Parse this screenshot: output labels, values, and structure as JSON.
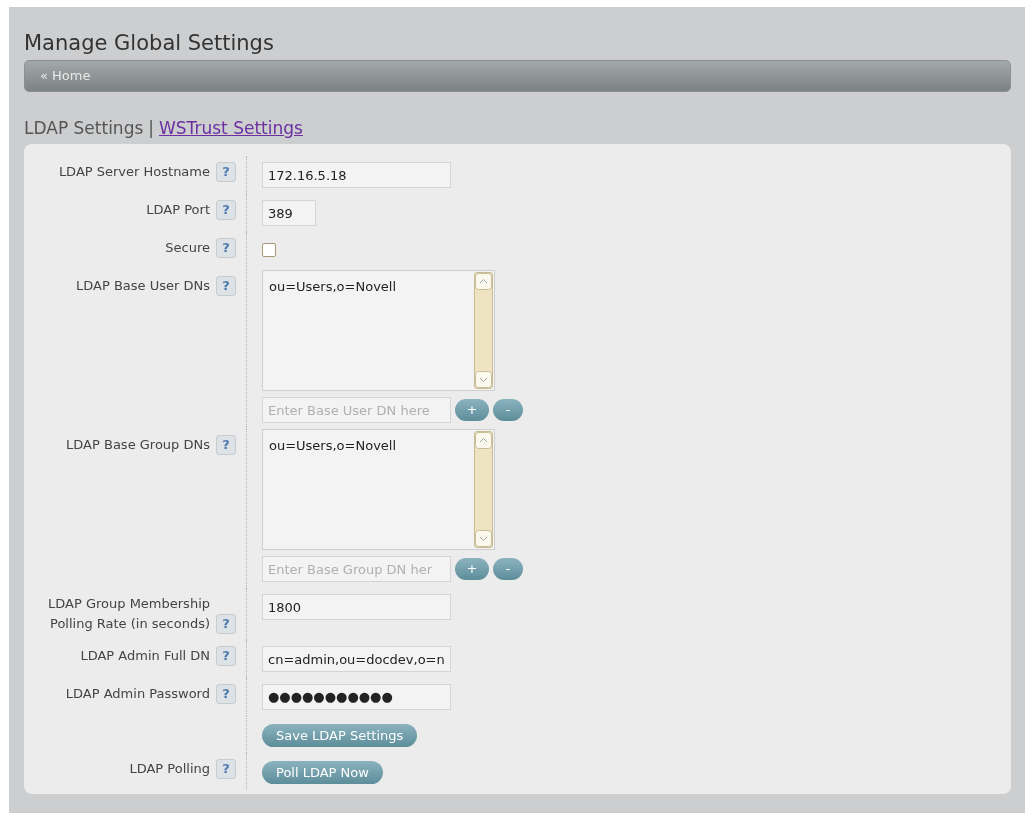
{
  "page": {
    "title": "Manage Global Settings"
  },
  "breadcrumb": {
    "label": "« Home"
  },
  "section_links": [
    {
      "label": "LDAP Settings",
      "kind": "current"
    },
    {
      "label": "WSTrust Settings",
      "kind": "link"
    }
  ],
  "section_separator": "|",
  "rows": [
    {
      "kind": "text",
      "label": "LDAP Server Hostname",
      "help": "?",
      "value": "172.16.5.18"
    },
    {
      "kind": "short_text",
      "label": "LDAP Port",
      "help": "?",
      "value": "389"
    },
    {
      "kind": "checkbox",
      "label": "Secure",
      "help": "?",
      "checked": false
    },
    {
      "kind": "list",
      "label": "LDAP Base User DNs",
      "help": "?",
      "value": "ou=Users,o=Novell",
      "placeholder": "Enter Base User DN here",
      "add": "+",
      "remove": "-"
    },
    {
      "kind": "list",
      "label": "LDAP Base Group DNs",
      "help": "?",
      "value": "ou=Users,o=Novell",
      "placeholder": "Enter Base Group DN her",
      "add": "+",
      "remove": "-"
    },
    {
      "kind": "text",
      "label": "LDAP Group Membership Polling Rate (in seconds)",
      "help": "?",
      "value": "1800"
    },
    {
      "kind": "text",
      "label": "LDAP Admin Full DN",
      "help": "?",
      "value": "cn=admin,ou=docdev,o=n"
    },
    {
      "kind": "password",
      "label": "LDAP Admin Password",
      "help": "?",
      "value": "●●●●●●●●●●●"
    },
    {
      "kind": "button",
      "button": "Save LDAP Settings"
    },
    {
      "kind": "button",
      "label": "LDAP Polling",
      "help": "?",
      "button": "Poll LDAP Now"
    }
  ]
}
